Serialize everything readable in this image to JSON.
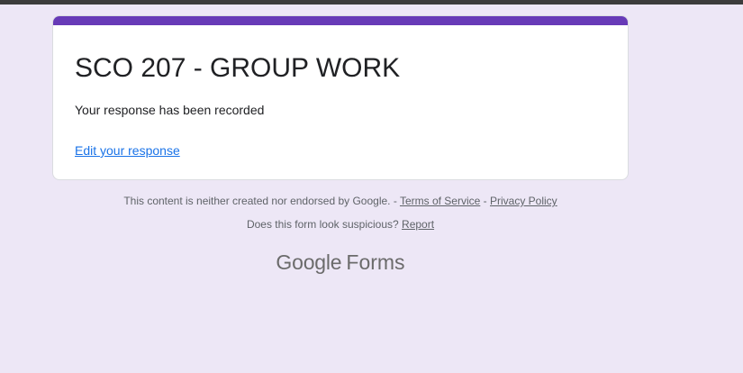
{
  "form": {
    "title": "SCO 207 - GROUP WORK",
    "confirmation": "Your response has been recorded",
    "edit_link": "Edit your response",
    "accent_color": "#673ab7",
    "background_color": "#ede7f6",
    "link_color": "#1a73e8"
  },
  "footer": {
    "disclaimer": "This content is neither created nor endorsed by Google. -",
    "separator": "-",
    "terms_link": "Terms of Service",
    "privacy_link": "Privacy Policy",
    "suspicious_text": "Does this form look suspicious?",
    "report_link": "Report"
  },
  "logo": {
    "brand": "Google",
    "product": "Forms",
    "icon_name": "google-forms-logo"
  }
}
